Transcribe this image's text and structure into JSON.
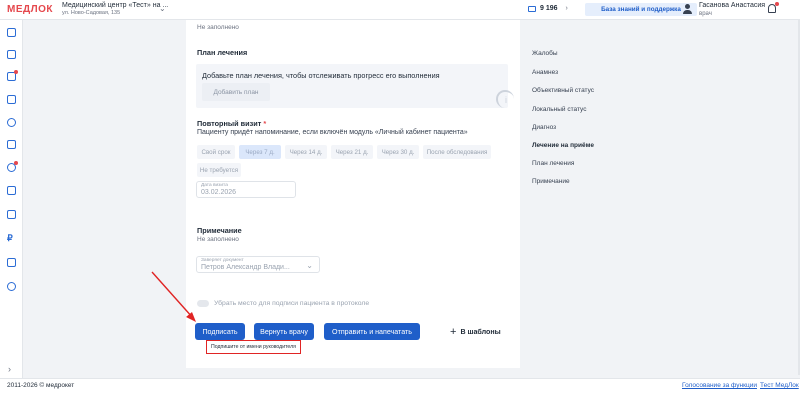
{
  "header": {
    "logo": "МЕДЛОК",
    "clinic_name": "Медицинский центр «Тест» на ...",
    "clinic_address": "ул. Ново-Садовая, 135",
    "balance": "9 196",
    "knowledge_base": "База знаний и поддержка",
    "user_name": "Гасанова Анастасия",
    "user_role": "врач"
  },
  "sidebar": {
    "icons": [
      "calendar-icon",
      "calendar-icon",
      "medical-case-icon",
      "checklist-icon",
      "patients-icon",
      "chart-icon",
      "stethoscope-icon",
      "bed-icon",
      "box-icon",
      "ruble-icon",
      "puzzle-icon",
      "settings-icon"
    ]
  },
  "form": {
    "top_value": "Не заполнено",
    "plan_title": "План лечения",
    "plan_prompt": "Добавьте план лечения, чтобы отслеживать прогресс его выполнения",
    "plan_button": "Добавить план",
    "revisit_title": "Повторный визит",
    "required_mark": "*",
    "revisit_note": "Пациенту придёт напоминание, если включён модуль «Личный кабинет пациента»",
    "chips": [
      "Свой срок",
      "Через 7 д.",
      "Через 14 д.",
      "Через 21 д.",
      "Через 30 д.",
      "После обследования",
      "Не требуется"
    ],
    "selected_chip": "Через 7 д.",
    "visit_date_label": "Дата визита",
    "visit_date": "03.02.2026",
    "note_title": "Примечание",
    "note_value": "Не заполнено",
    "certifier_label": "Заверяет документ",
    "certifier_value": "Петров Александр Влади...",
    "remove_signature": "Убрать место для подписи пациента в протоколе",
    "btn_sign": "Подписать",
    "btn_return": "Вернуть врачу",
    "btn_send_print": "Отправить и напечатать",
    "btn_templates": "В шаблоны",
    "hint": "Подпишите от имени руководителя"
  },
  "right_nav": {
    "items": [
      "Жалобы",
      "Анамнез",
      "Объективный статус",
      "Локальный статус",
      "Диагноз",
      "Лечение на приёме",
      "План лечения",
      "Примечание"
    ],
    "active": "Лечение на приёме"
  },
  "footer": {
    "copyright": "2011-2026 © медрокет",
    "link1": "Голосование за функции",
    "link2": "Тест МедЛок"
  },
  "colors": {
    "accent": "#1f5ec9",
    "logo": "#e5484d",
    "annotation": "#e02424"
  }
}
